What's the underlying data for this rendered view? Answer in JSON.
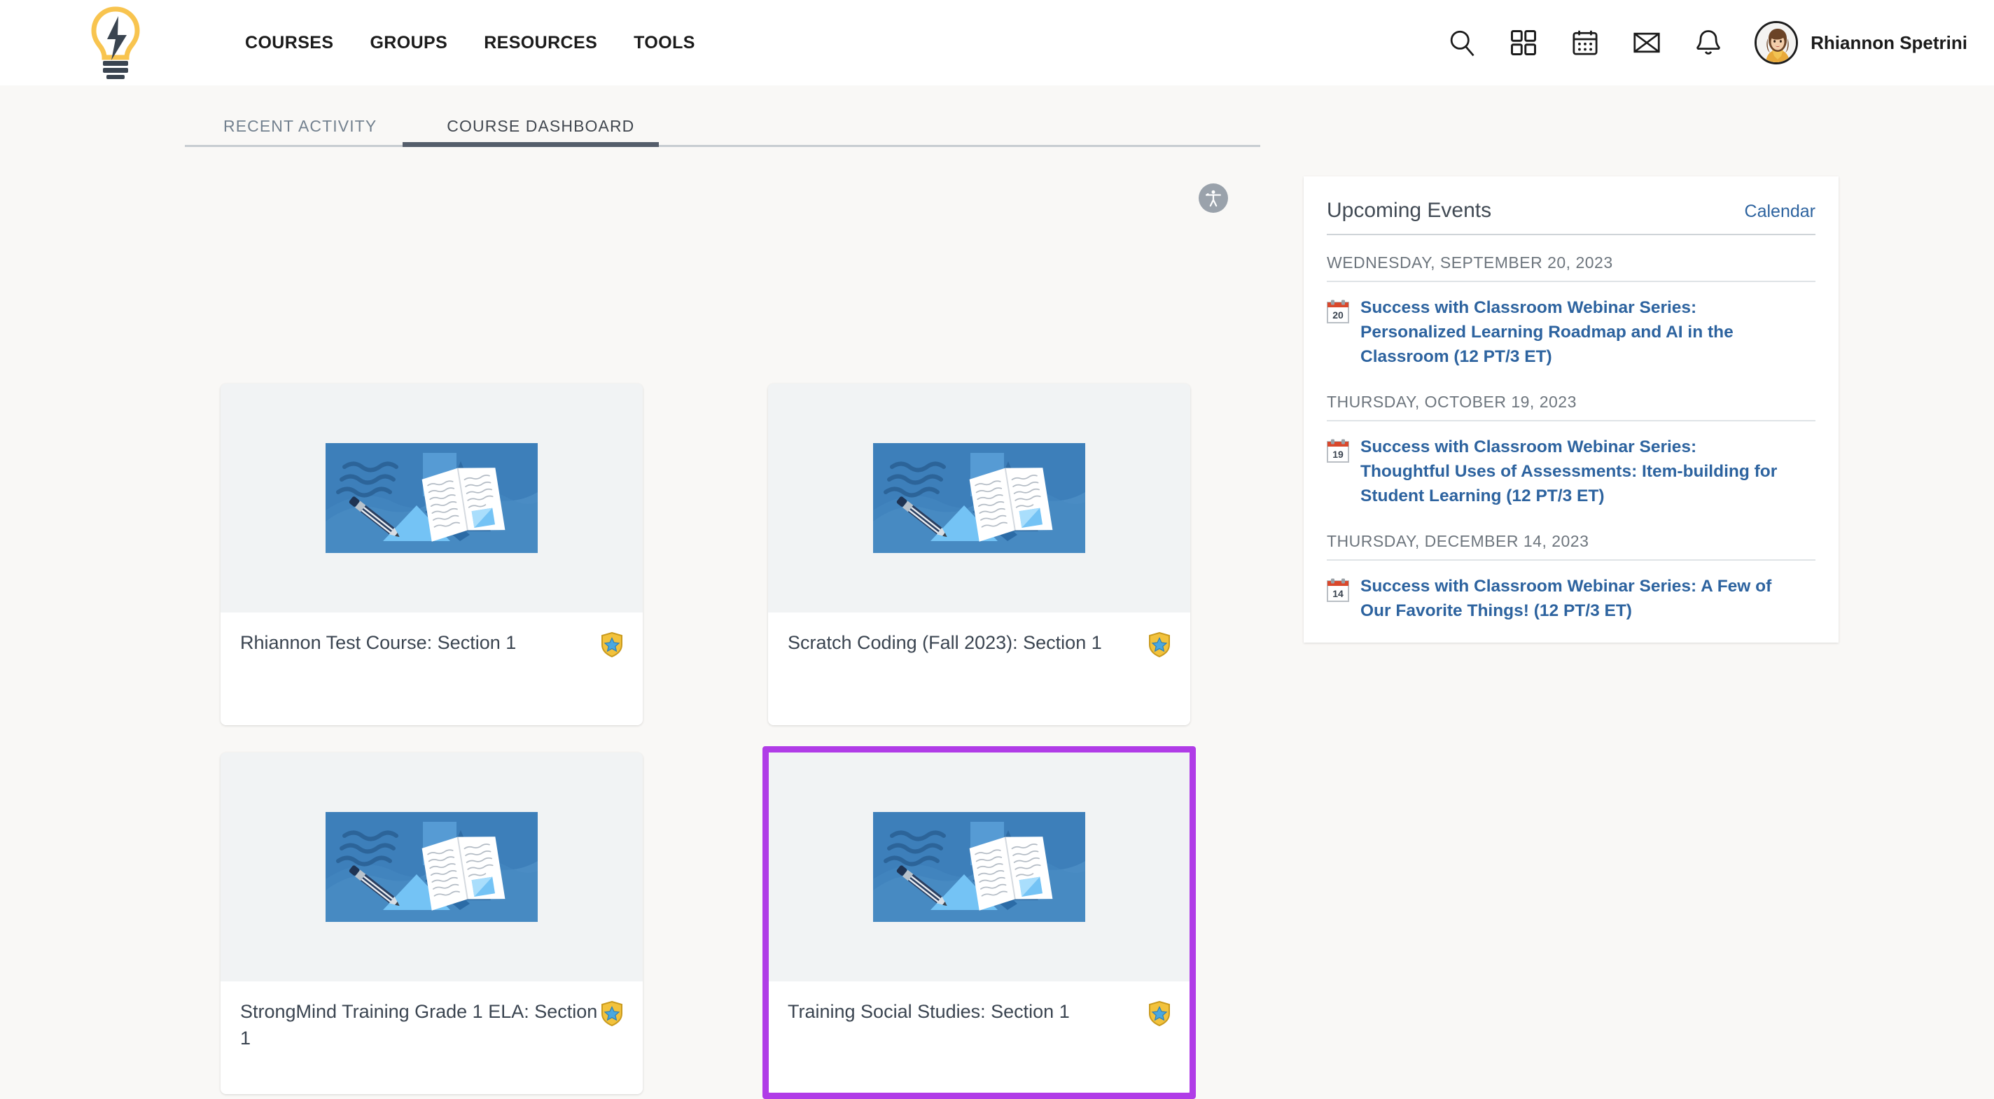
{
  "header": {
    "logo_icon": "lightbulb-lightning-logo",
    "nav": [
      {
        "label": "COURSES"
      },
      {
        "label": "GROUPS"
      },
      {
        "label": "RESOURCES"
      },
      {
        "label": "TOOLS"
      }
    ],
    "icons": [
      {
        "name": "search-icon"
      },
      {
        "name": "apps-grid-icon"
      },
      {
        "name": "calendar-icon"
      },
      {
        "name": "mail-icon"
      },
      {
        "name": "notifications-bell-icon"
      }
    ],
    "user": {
      "name": "Rhiannon Spetrini",
      "avatar_icon": "user-avatar"
    }
  },
  "tabs": [
    {
      "label": "RECENT ACTIVITY",
      "active": false
    },
    {
      "label": "COURSE DASHBOARD",
      "active": true
    }
  ],
  "accessibility": {
    "icon": "accessibility-icon"
  },
  "courses": [
    {
      "title": "Rhiannon Test Course: Section 1",
      "badge_icon": "shield-star-badge",
      "highlighted": false
    },
    {
      "title": "Scratch Coding (Fall 2023): Section 1",
      "badge_icon": "shield-star-badge",
      "highlighted": false
    },
    {
      "title": "StrongMind Training Grade 1 ELA: Section 1",
      "badge_icon": "shield-star-badge",
      "highlighted": false
    },
    {
      "title": "Training Social Studies: Section 1",
      "badge_icon": "shield-star-badge",
      "highlighted": true
    }
  ],
  "upcoming_events": {
    "title": "Upcoming Events",
    "calendar_link": "Calendar",
    "groups": [
      {
        "date": "WEDNESDAY, SEPTEMBER 20, 2023",
        "items": [
          {
            "day": "20",
            "title": "Success with Classroom Webinar Series: Personalized Learning Roadmap and AI in the Classroom (12 PT/3 ET)"
          }
        ]
      },
      {
        "date": "THURSDAY, OCTOBER 19, 2023",
        "items": [
          {
            "day": "19",
            "title": "Success with Classroom Webinar Series: Thoughtful Uses of Assessments: Item-building for Student Learning (12 PT/3 ET)"
          }
        ]
      },
      {
        "date": "THURSDAY, DECEMBER 14, 2023",
        "items": [
          {
            "day": "14",
            "title": "Success with Classroom Webinar Series: A Few of Our Favorite Things! (12 PT/3 ET)"
          }
        ]
      }
    ]
  },
  "colors": {
    "page_bg": "#f9f8f6",
    "header_bg": "#ffffff",
    "accent_link": "#2d639f",
    "highlight_border": "#b03ce7",
    "tab_active": "#555e6b",
    "badge_gold": "#f2c23c",
    "badge_star": "#49a8e0",
    "logo_yellow": "#f8c44f"
  }
}
